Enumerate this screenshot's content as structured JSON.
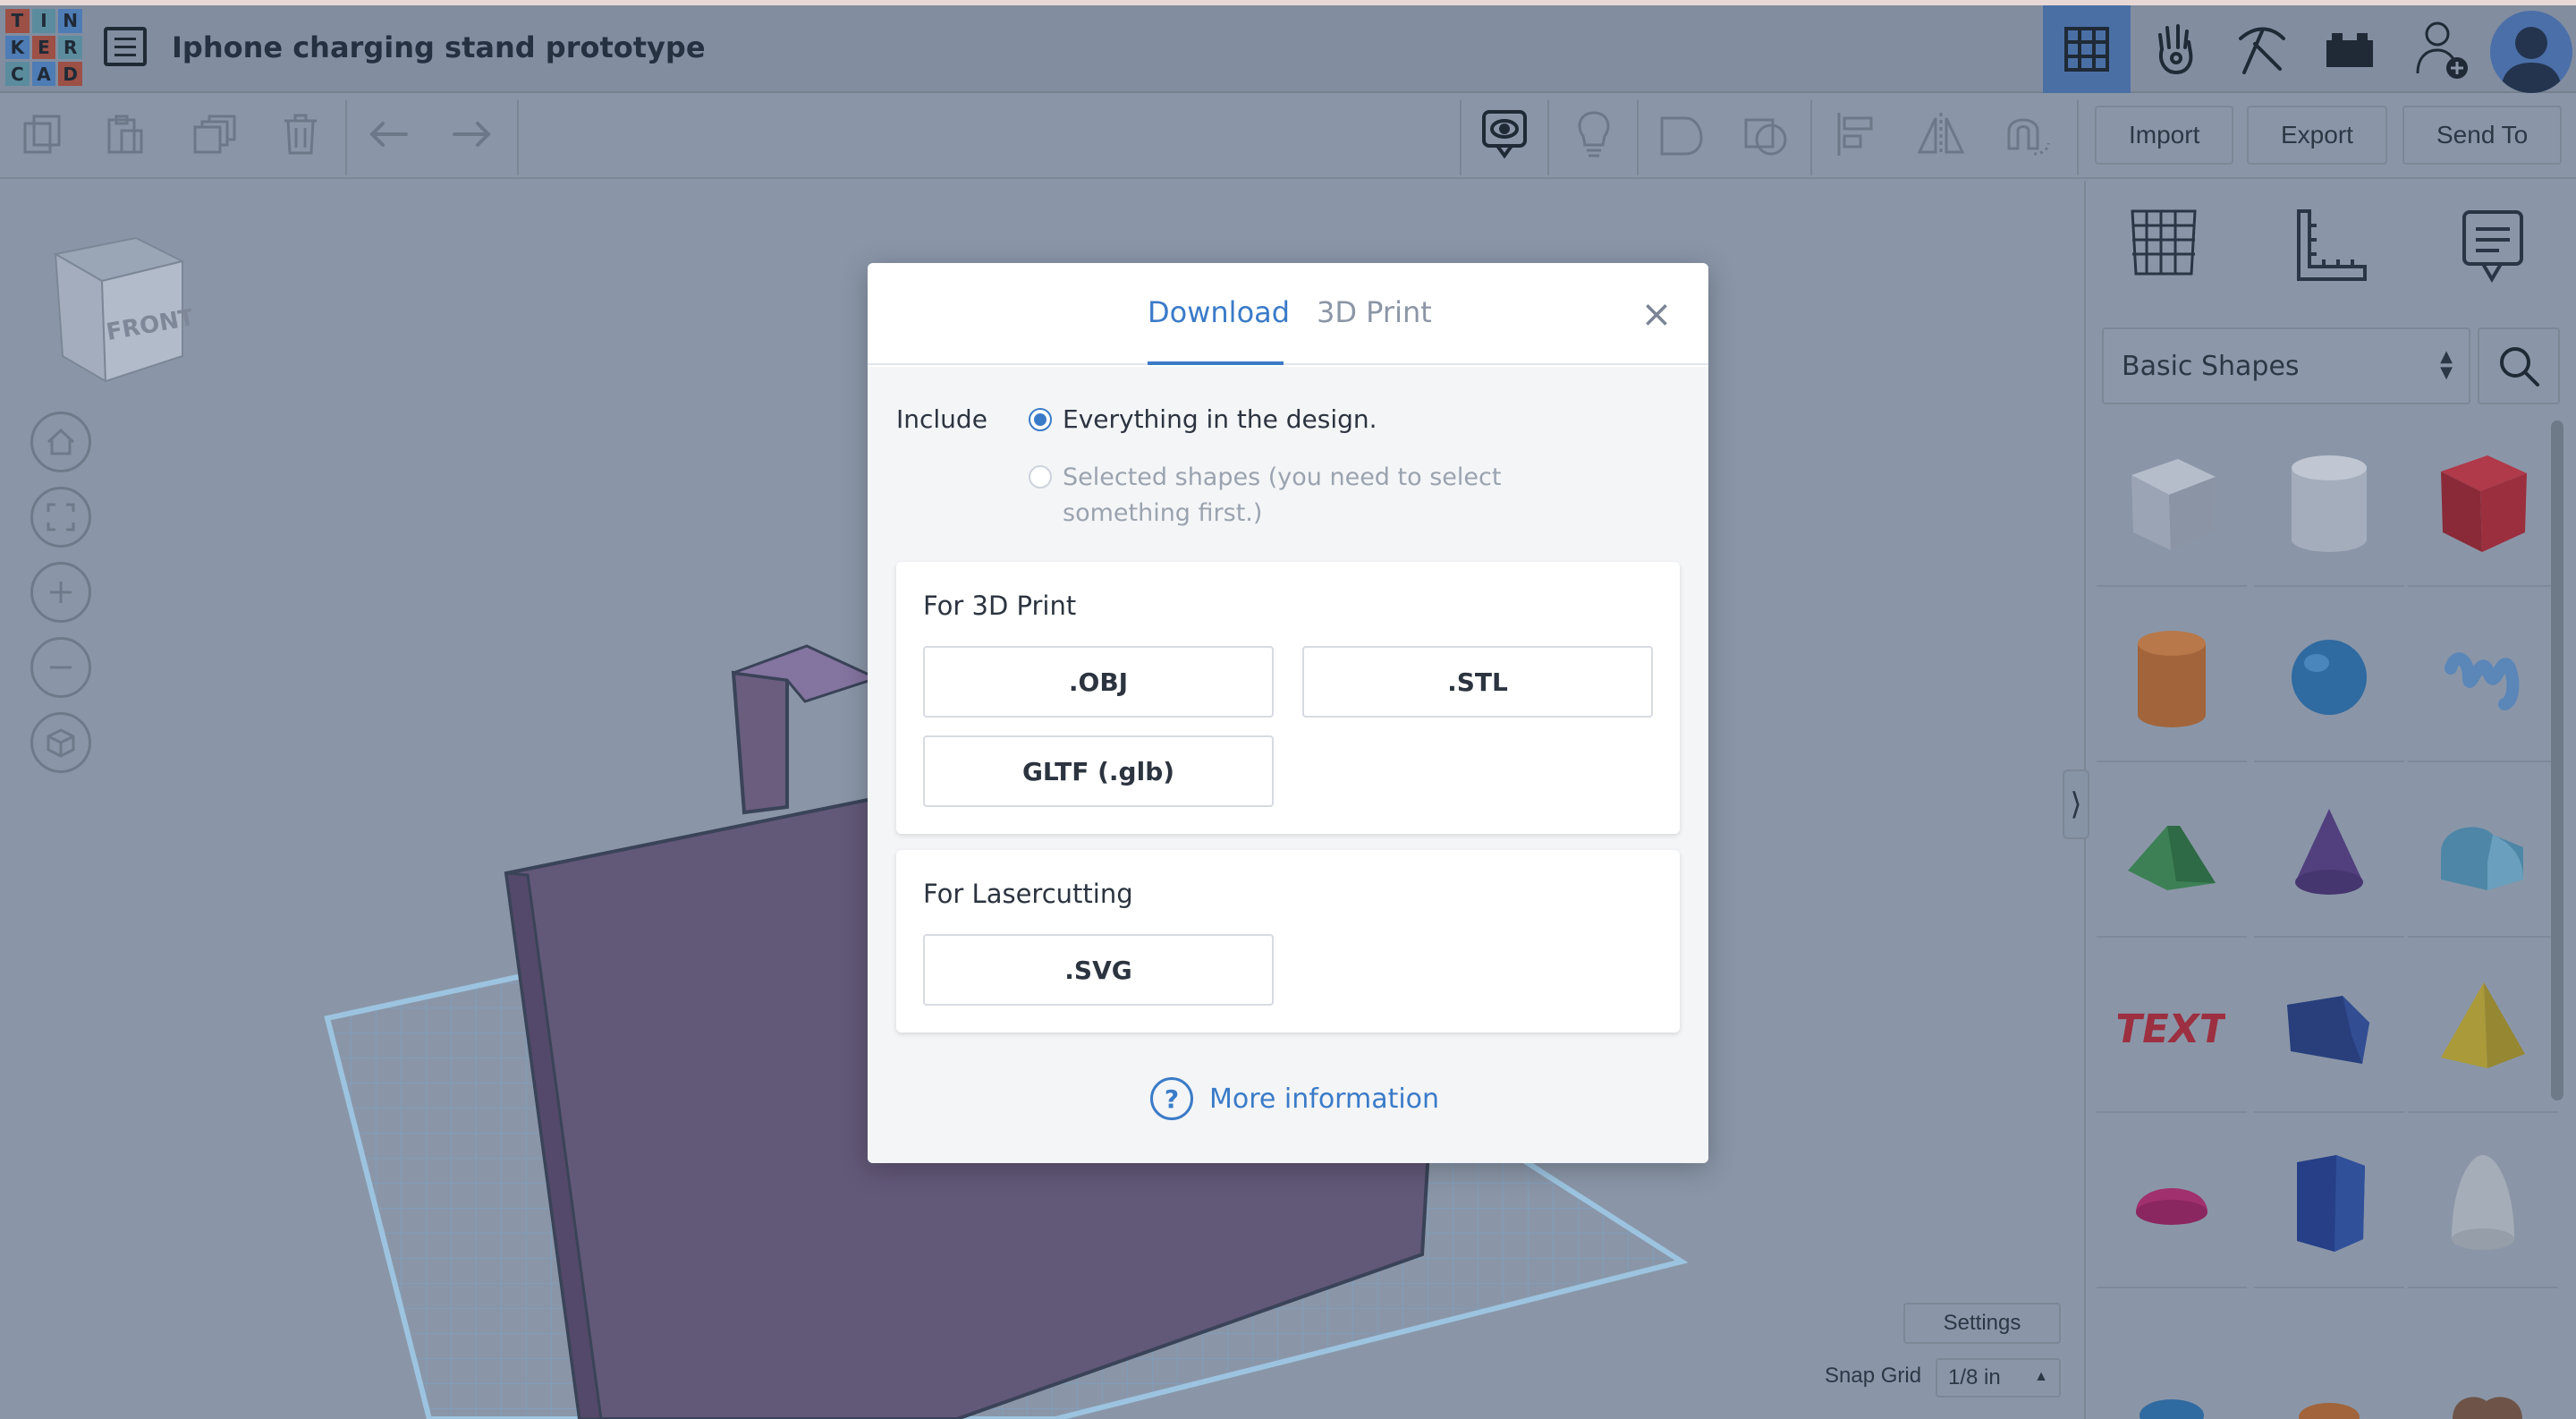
{
  "app": {
    "logo_letters": [
      "T",
      "I",
      "N",
      "K",
      "E",
      "R",
      "C",
      "A",
      "D"
    ],
    "design_title": "Iphone charging stand prototype"
  },
  "header_icons": [
    "grid-view-icon",
    "hands-on-icon",
    "pickaxe-icon",
    "bricks-icon",
    "add-user-icon",
    "avatar"
  ],
  "toolbar": {
    "left_tools": [
      "copy-icon",
      "paste-icon",
      "duplicate-icon",
      "delete-icon",
      "undo-icon",
      "redo-icon"
    ],
    "right_tools": [
      "show-notes-icon",
      "light-bulb-icon",
      "group-icon",
      "ungroup-icon",
      "align-icon",
      "mirror-icon",
      "magnet-icon"
    ],
    "import_label": "Import",
    "export_label": "Export",
    "send_to_label": "Send To"
  },
  "viewcube": {
    "face_label": "FRONT"
  },
  "panel": {
    "tabs": [
      "workplane-icon",
      "ruler-icon",
      "notes-icon"
    ],
    "category": "Basic Shapes",
    "shapes": [
      {
        "name": "box-hole",
        "color": "#9aa4b4"
      },
      {
        "name": "cylinder-hole",
        "color": "#a4adbb"
      },
      {
        "name": "box",
        "color": "#9b2f3e"
      },
      {
        "name": "cylinder",
        "color": "#a2643a"
      },
      {
        "name": "sphere",
        "color": "#2f6aa1"
      },
      {
        "name": "scribble",
        "color": "#5a86b8"
      },
      {
        "name": "roof",
        "color": "#3d8056"
      },
      {
        "name": "cone",
        "color": "#52407e"
      },
      {
        "name": "round-roof",
        "color": "#4d86a6"
      },
      {
        "name": "text",
        "color": "#9c3040"
      },
      {
        "name": "wedge",
        "color": "#283f7c"
      },
      {
        "name": "pyramid",
        "color": "#aa9a3a"
      },
      {
        "name": "half-sphere",
        "color": "#a0306e"
      },
      {
        "name": "polygon",
        "color": "#263f86"
      },
      {
        "name": "paraboloid",
        "color": "#a5adb8"
      }
    ]
  },
  "workplane": {
    "settings_label": "Settings",
    "snap_grid_label": "Snap Grid",
    "snap_grid_value": "1/8 in"
  },
  "modal": {
    "tab_download": "Download",
    "tab_3dprint": "3D Print",
    "include_label": "Include",
    "option_everything": "Everything in the design.",
    "option_selected": "Selected shapes (you need to select something first.)",
    "section_3dprint": "For 3D Print",
    "btn_obj": ".OBJ",
    "btn_stl": ".STL",
    "btn_gltf": "GLTF (.glb)",
    "section_laser": "For Lasercutting",
    "btn_svg": ".SVG",
    "more_info": "More information"
  }
}
